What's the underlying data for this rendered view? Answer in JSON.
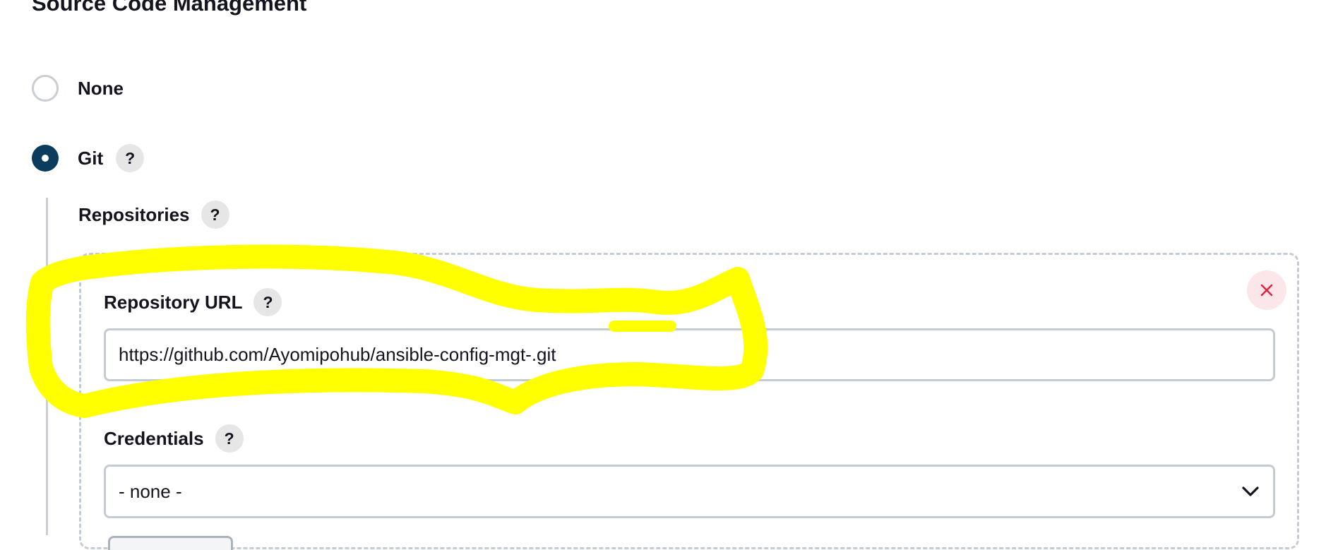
{
  "section": {
    "title": "Source Code Management"
  },
  "scm_options": [
    {
      "label": "None",
      "selected": false
    },
    {
      "label": "Git",
      "selected": true
    }
  ],
  "help_glyph": "?",
  "git": {
    "repositories_label": "Repositories",
    "repository": {
      "url_label": "Repository URL",
      "url_value": "https://github.com/Ayomipohub/ansible-config-mgt-.git",
      "credentials_label": "Credentials",
      "credentials_value": "- none -"
    }
  },
  "icons": {
    "help": "question-mark-icon",
    "delete": "close-icon",
    "dropdown": "chevron-down-icon"
  },
  "colors": {
    "radio_selected": "#0b3c5d",
    "radio_unselected_border": "#c7cdd3",
    "delete_bg": "#fbe7ea",
    "delete_icon": "#e0243c",
    "highlight": "#ffff00"
  }
}
